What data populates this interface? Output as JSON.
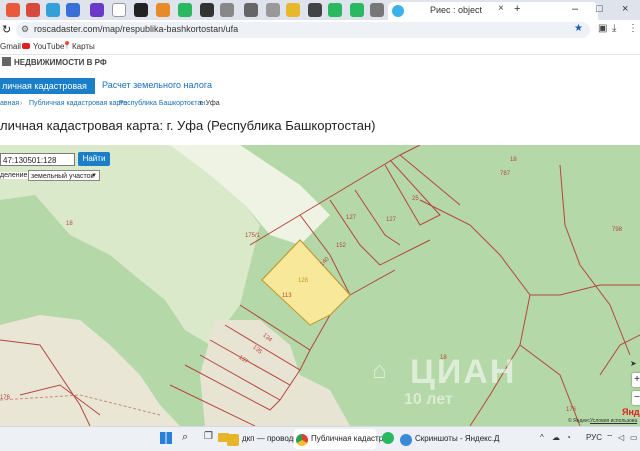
{
  "browser": {
    "active_tab_title": "Риес : object",
    "tab_close": "×",
    "new_tab": "+",
    "window_controls": [
      "–",
      "□",
      "×"
    ],
    "url": "roscadaster.com/map/respublika-bashkortostan/ufa",
    "bookmarks": [
      "Gmail",
      "YouTube",
      "Карты"
    ]
  },
  "site": {
    "logo_text": "НЕДВИЖИМОСТИ В РФ",
    "nav_active": "личная кадастровая карта",
    "nav_tab": "Расчет земельного налога",
    "breadcrumbs": [
      "авная",
      "Публичная кадастровая карта",
      "Республика Башкортостан",
      "г. Уфа"
    ],
    "breadcrumb_separator": "›",
    "heading": "личная кадастровая карта: г. Уфа (Республика Башкортостан)"
  },
  "map": {
    "search_value": "47:130501:128",
    "find_button": "Найти",
    "type_label": "деление:",
    "type_value": "земельный участок",
    "zoom_in": "+",
    "zoom_out": "−",
    "parcel_labels": [
      "175/1",
      "127",
      "127",
      "25",
      "152",
      "140",
      "128",
      "113",
      "134",
      "135",
      "137",
      "18",
      "18",
      "18",
      "787",
      "798",
      "176",
      "176"
    ],
    "watermark": "ЦИАН",
    "watermark_sub": "10 лет",
    "yandex_logo": "Янде",
    "attribution": "© Яндекс",
    "terms_link": "Условия использова"
  },
  "taskbar": {
    "apps": [
      "дкп — проводник",
      "Публичная кадастра",
      "Скриншоты - Яндекс.Д"
    ],
    "language": "РУС"
  },
  "colors": {
    "map_green": "#b4d8a7",
    "clearing": "#f2f0e4",
    "selected_parcel": "#f8e89a",
    "boundary": "#b5473f",
    "accent": "#1a7fc8"
  }
}
